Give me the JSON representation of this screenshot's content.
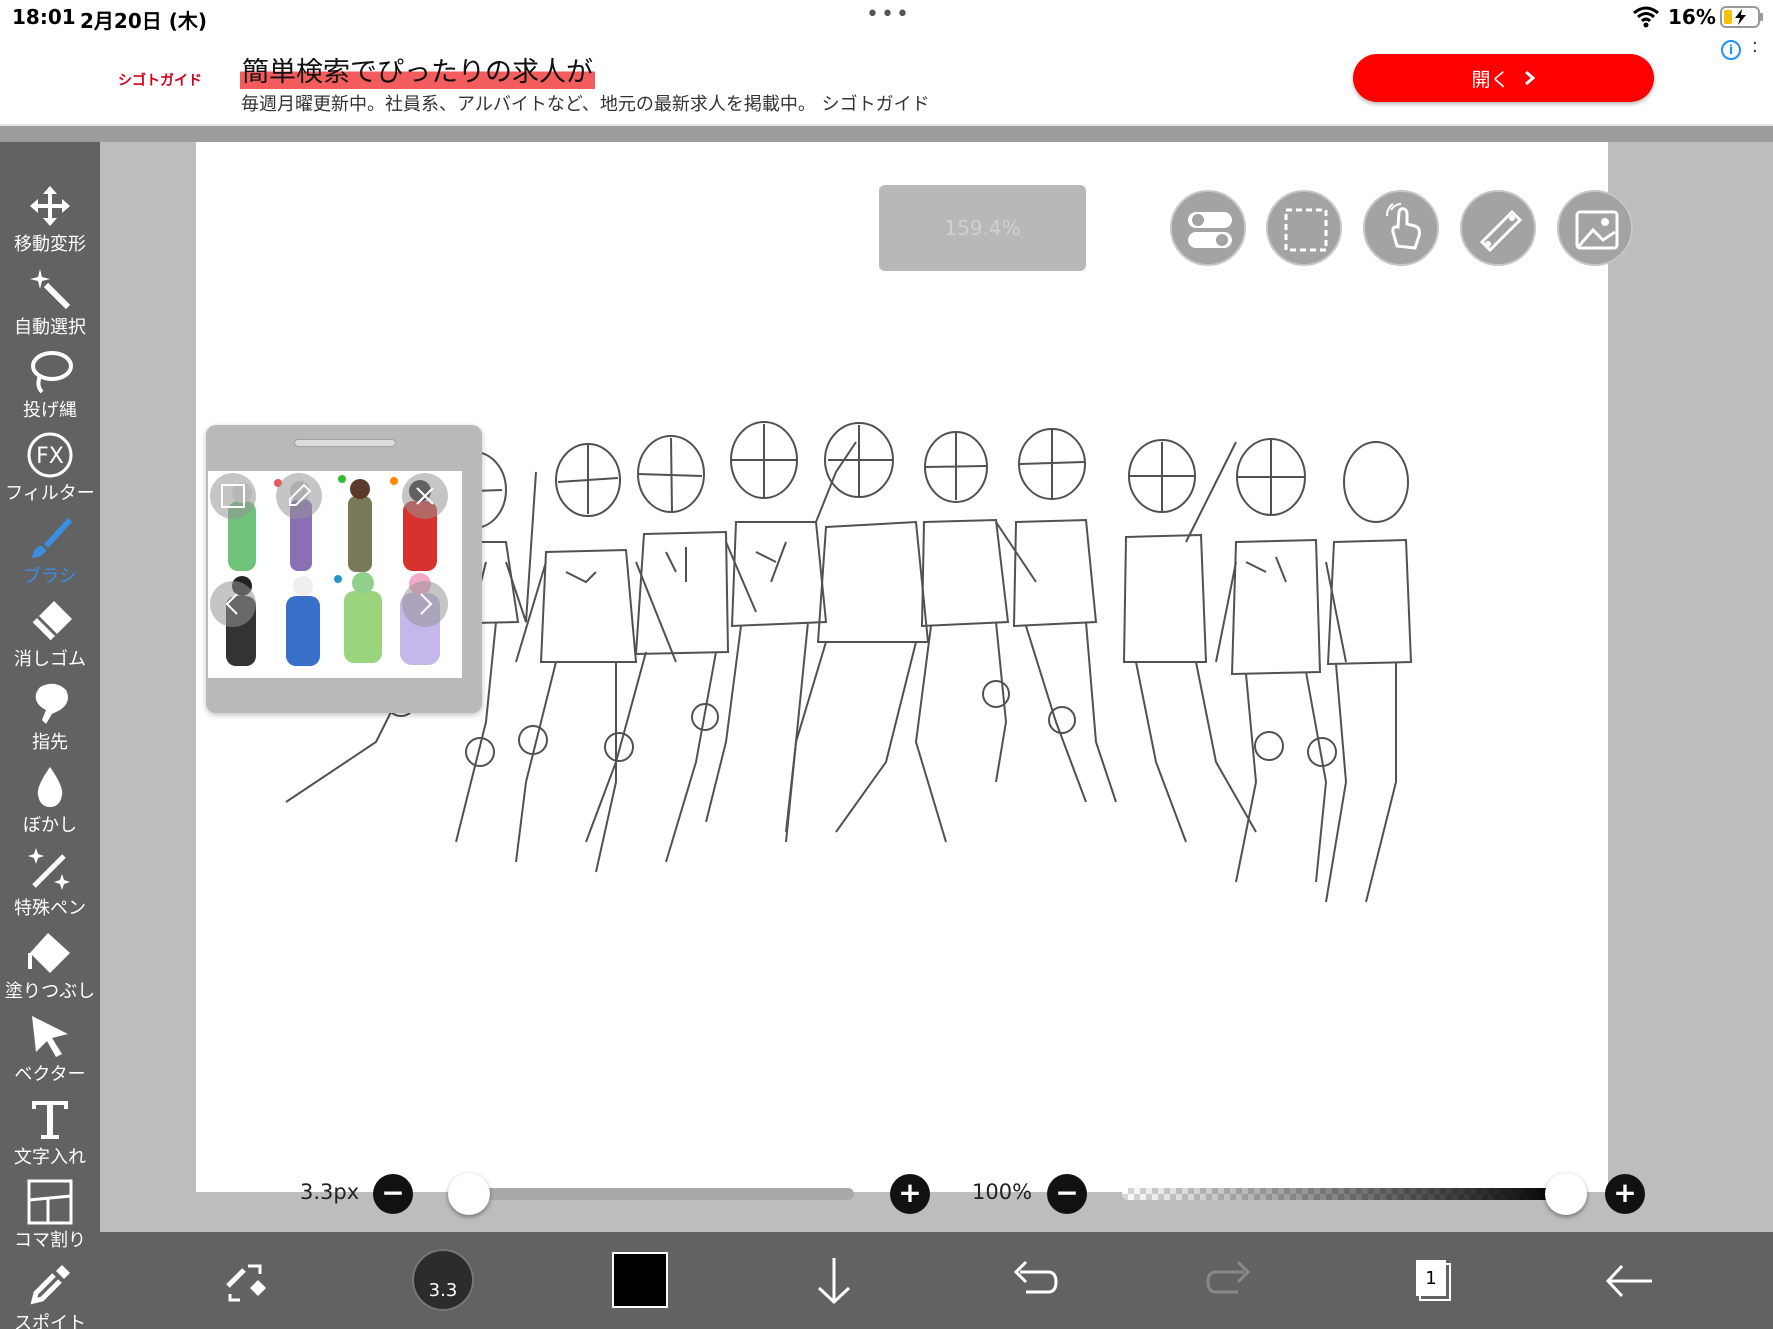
{
  "status_bar": {
    "time": "18:01",
    "date": "2月20日 (木)",
    "dots": "•••",
    "battery_percent": "16%"
  },
  "ad": {
    "logo_text": "シゴトガイド",
    "title": "簡単検索でぴったりの求人が",
    "description": "毎週月曜更新中。社員系、アルバイトなど、地元の最新求人を掲載中。 シゴトガイド",
    "open_label": "開く",
    "info": "i"
  },
  "tools": [
    {
      "label": "移動変形",
      "icon": "move-icon"
    },
    {
      "label": "自動選択",
      "icon": "magic-wand-icon"
    },
    {
      "label": "投げ縄",
      "icon": "lasso-icon"
    },
    {
      "label": "フィルター",
      "icon": "fx-icon"
    },
    {
      "label": "ブラシ",
      "icon": "brush-icon"
    },
    {
      "label": "消しゴム",
      "icon": "eraser-icon"
    },
    {
      "label": "指先",
      "icon": "finger-icon"
    },
    {
      "label": "ぼかし",
      "icon": "blur-drop-icon"
    },
    {
      "label": "特殊ペン",
      "icon": "sparkle-pen-icon"
    },
    {
      "label": "塗りつぶし",
      "icon": "fill-bucket-icon"
    },
    {
      "label": "ベクター",
      "icon": "vector-cursor-icon"
    },
    {
      "label": "文字入れ",
      "icon": "text-icon"
    },
    {
      "label": "コマ割り",
      "icon": "frame-divide-icon"
    },
    {
      "label": "スポイト",
      "icon": "eyedropper-icon"
    }
  ],
  "active_tool": "ブラシ",
  "canvas": {
    "zoom_display": "159.4%"
  },
  "fx_text": "FX",
  "brush": {
    "size_label": "3.3px",
    "size_value": 3.3,
    "size_badge": "3.3",
    "size_fraction": 0.01,
    "opacity_label": "100%",
    "opacity_fraction": 1.0,
    "minus": "−",
    "plus": "+"
  },
  "layers": {
    "count": "1"
  },
  "colors": {
    "brush_color": "#000000",
    "accent": "#3a8ee6",
    "ad_button": "#ff0000"
  }
}
